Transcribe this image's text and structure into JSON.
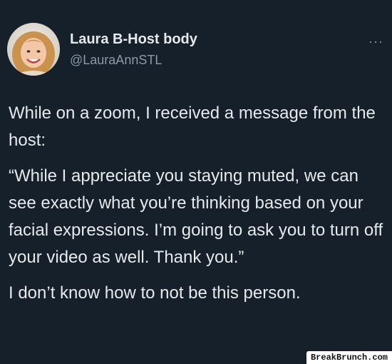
{
  "author": {
    "display_name": "Laura B-Host body",
    "handle": "@LauraAnnSTL"
  },
  "actions": {
    "more_label": "···"
  },
  "tweet": {
    "paragraphs": [
      "While on a zoom, I received a message from the host:",
      "“While I appreciate you staying muted, we can see exactly what you’re thinking based on your facial expressions. I’m going to ask you to turn off your video as well. Thank you.”",
      "I don’t know how to not be this person."
    ]
  },
  "watermark": {
    "text": "BreakBrunch.com"
  },
  "colors": {
    "background": "#15202b",
    "text": "#e7e9ea",
    "secondary": "#8b98a5"
  }
}
